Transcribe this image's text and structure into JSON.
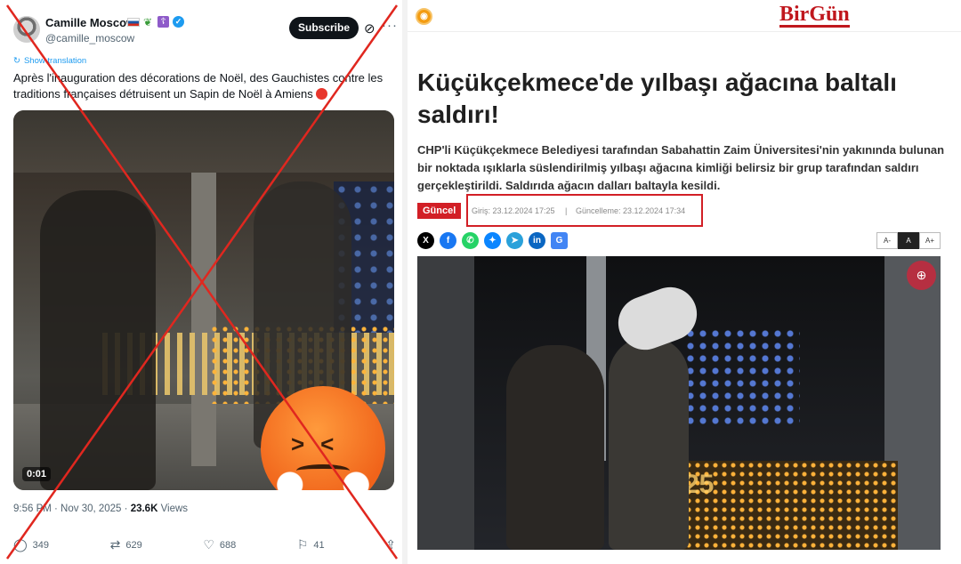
{
  "tweet": {
    "display_name": "Camille Moscow",
    "handle": "@camille_moscow",
    "subscribe_label": "Subscribe",
    "show_translation": "Show translation",
    "text": "Après l'inauguration des décorations de Noël, des Gauchistes contre les traditions françaises détruisent un Sapin de Noël à Amiens",
    "video_time": "0:01",
    "time_date": "9:56 PM · Nov 30, 2025 · ",
    "views_count": "23.6K",
    "views_label": " Views",
    "replies": "349",
    "reposts": "629",
    "likes": "688",
    "bookmarks": "41",
    "overlay": "red-x-mark"
  },
  "article": {
    "logo": "BirGün",
    "headline": "Küçükçekmece'de yılbaşı ağacına baltalı saldırı!",
    "summary": "CHP'li Küçükçekmece Belediyesi tarafından Sabahattin Zaim Üniversitesi'nin yakınında bulunan bir noktada ışıklarla süslendirilmiş yılbaşı ağacına kimliği belirsiz bir grup tarafından saldırı gerçekleştirildi. Saldırıda ağacın dalları baltayla kesildi.",
    "category": "Güncel",
    "published": "Giriş: 23.12.2024 17:25",
    "separator": "|",
    "updated": "Güncelleme: 23.12.2024 17:34",
    "font_sizes": [
      "A-",
      "A",
      "A+"
    ],
    "share_icons": [
      "x-icon",
      "facebook-icon",
      "whatsapp-icon",
      "bluesky-icon",
      "telegram-icon",
      "linkedin-icon",
      "google-news-icon"
    ],
    "photo_number": "25"
  },
  "colors": {
    "accent_red": "#d21f26",
    "twitter_blue": "#1d9bf0",
    "x_mark": "#e0271f"
  }
}
